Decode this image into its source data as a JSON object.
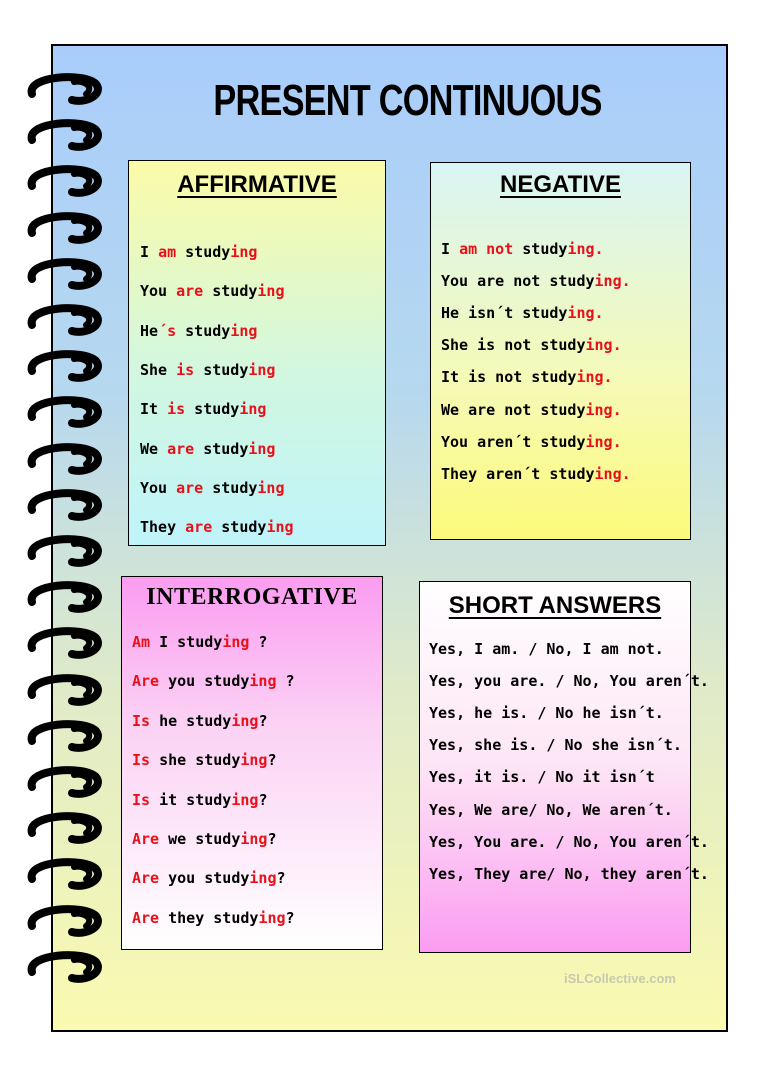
{
  "title": "PRESENT CONTINUOUS",
  "affirmative": {
    "heading": "AFFIRMATIVE",
    "lines": [
      [
        "I ",
        "am",
        " study",
        "ing",
        ""
      ],
      [
        "You ",
        "are",
        " study",
        "ing",
        ""
      ],
      [
        "He",
        "´s",
        " study",
        "ing",
        ""
      ],
      [
        "She ",
        "is",
        " study",
        "ing",
        ""
      ],
      [
        "It ",
        "is",
        " study",
        "ing",
        ""
      ],
      [
        "We ",
        "are",
        " study",
        "ing",
        ""
      ],
      [
        "You ",
        "are",
        " study",
        "ing",
        ""
      ],
      [
        "They ",
        "are",
        " study",
        "ing",
        ""
      ]
    ]
  },
  "negative": {
    "heading": "NEGATIVE",
    "lines": [
      [
        "I ",
        "am not",
        " study",
        "ing.",
        ""
      ],
      [
        "You are not study",
        "",
        "",
        "ing.",
        ""
      ],
      [
        "He isn´t study",
        "",
        "",
        "ing.",
        ""
      ],
      [
        "She is not study",
        "",
        "",
        "ing.",
        ""
      ],
      [
        "It is not study",
        "",
        "",
        "ing.",
        ""
      ],
      [
        "We are not study",
        "",
        "",
        "ing.",
        ""
      ],
      [
        "You aren´t study",
        "",
        "",
        "ing.",
        ""
      ],
      [
        "They aren´t study",
        "",
        "",
        "ing.",
        ""
      ]
    ]
  },
  "interrogative": {
    "heading": "INTERROGATIVE",
    "lines": [
      [
        "",
        "Am",
        " I study",
        "ing",
        " ?"
      ],
      [
        "",
        "Are",
        " you study",
        "ing",
        " ?"
      ],
      [
        "",
        "Is",
        " he study",
        "ing",
        "?"
      ],
      [
        "",
        "Is",
        "  she study",
        "ing",
        "?"
      ],
      [
        "",
        "Is",
        "  it study",
        "ing",
        "?"
      ],
      [
        "",
        "Are",
        " we study",
        "ing",
        "?"
      ],
      [
        "",
        "Are",
        " you study",
        "ing",
        "?"
      ],
      [
        "",
        "Are",
        " they study",
        "ing",
        "?"
      ]
    ]
  },
  "short_answers": {
    "heading": "SHORT ANSWERS",
    "lines": [
      "Yes, I am. / No, I am not.",
      "Yes, you are. / No, You aren´t.",
      "Yes, he is. / No he isn´t.",
      "Yes, she is. / No she isn´t.",
      "Yes, it is. / No it isn´t",
      "Yes, We are/ No, We aren´t.",
      "Yes, You are. / No, You aren´t.",
      "Yes, They are/ No, they aren´t."
    ]
  },
  "colors": {
    "highlight": "#e8111a",
    "text": "#000000"
  },
  "watermark": "iSLCollective.com"
}
